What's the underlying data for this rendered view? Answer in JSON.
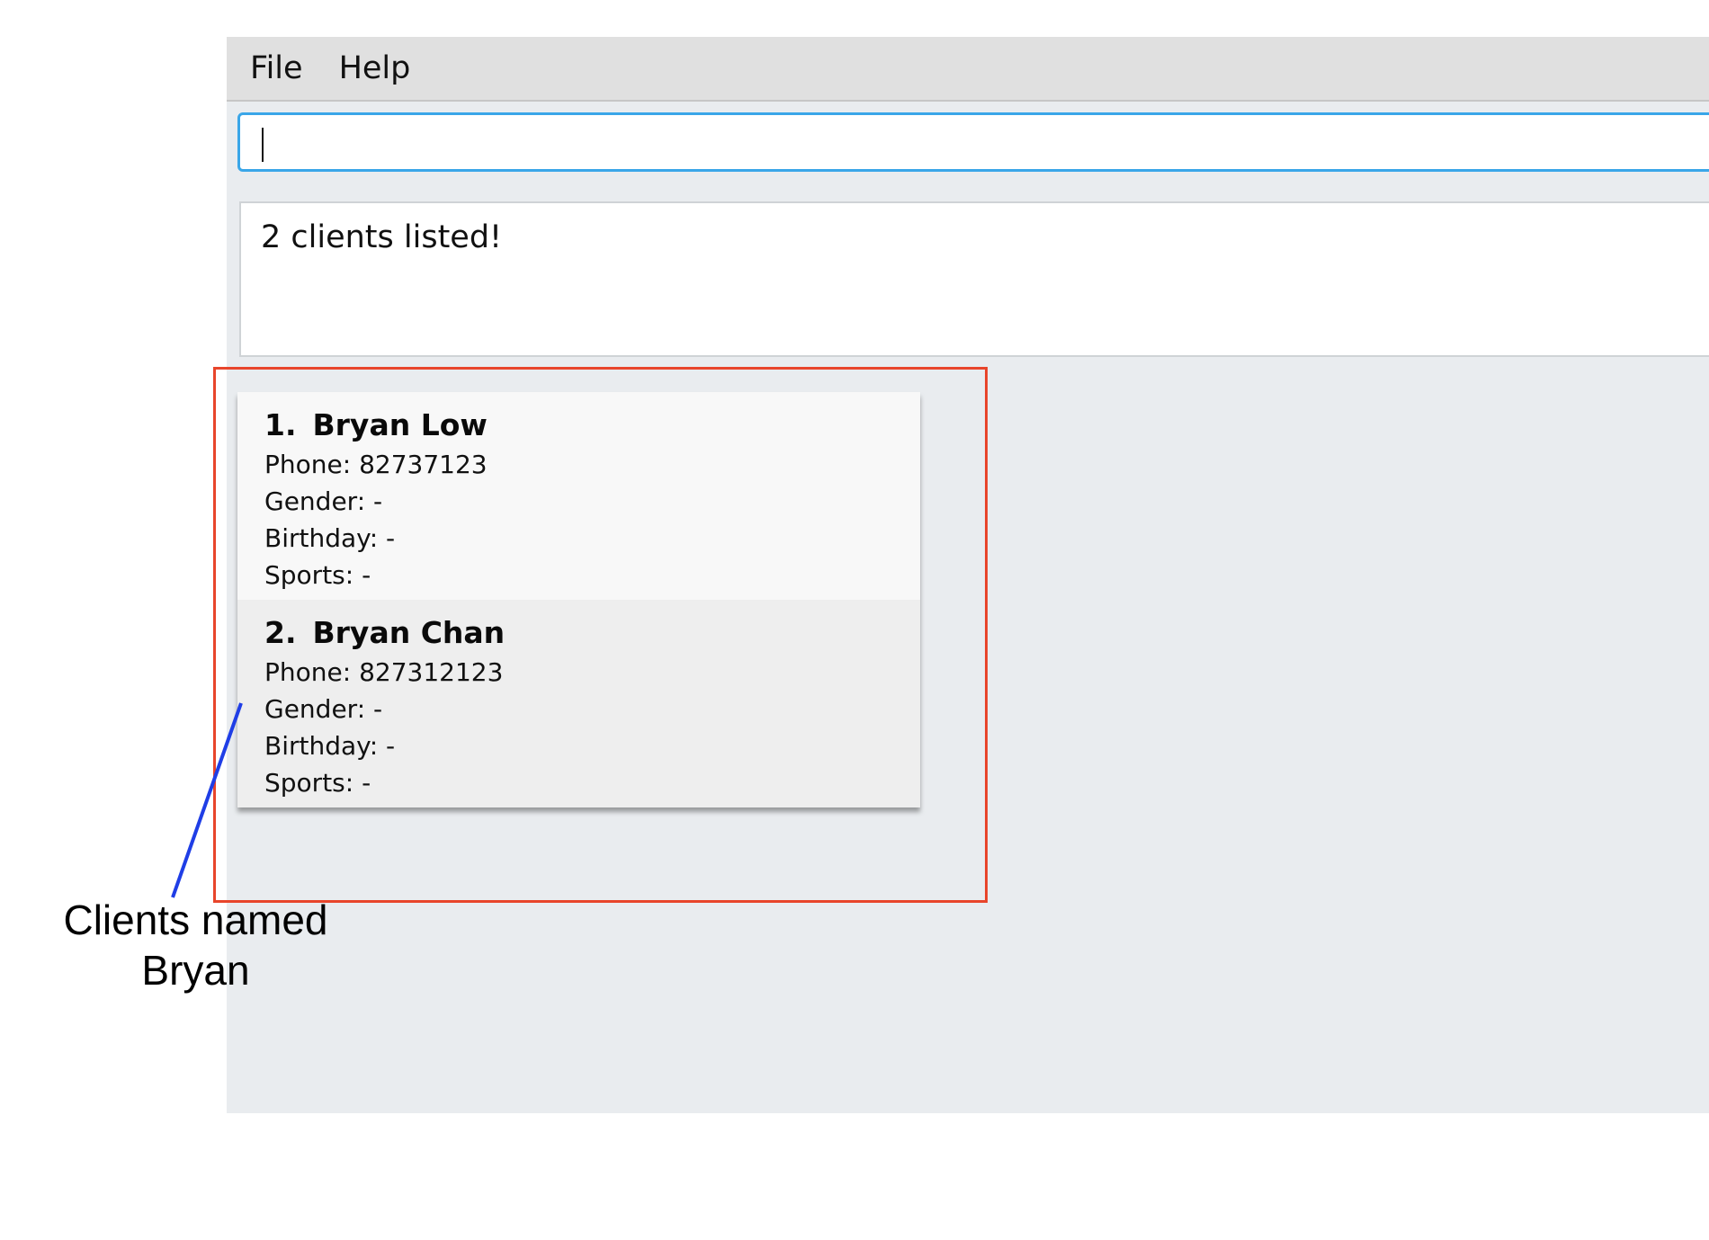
{
  "menu": {
    "file_label": "File",
    "help_label": "Help"
  },
  "command": {
    "value": ""
  },
  "result": {
    "message": "2 clients listed!"
  },
  "clients": [
    {
      "index": "1.",
      "name": "Bryan Low",
      "phone": "Phone: 82737123",
      "gender": "Gender: -",
      "birthday": "Birthday: -",
      "sports": "Sports: -"
    },
    {
      "index": "2.",
      "name": "Bryan Chan",
      "phone": "Phone: 827312123",
      "gender": "Gender: -",
      "birthday": "Birthday: -",
      "sports": "Sports: -"
    }
  ],
  "annotation": {
    "line1": "Clients named",
    "line2": "Bryan"
  },
  "colors": {
    "highlight_box": "#e8452b",
    "pointer_line": "#1f3ee6",
    "input_focus": "#3aa6e8"
  }
}
